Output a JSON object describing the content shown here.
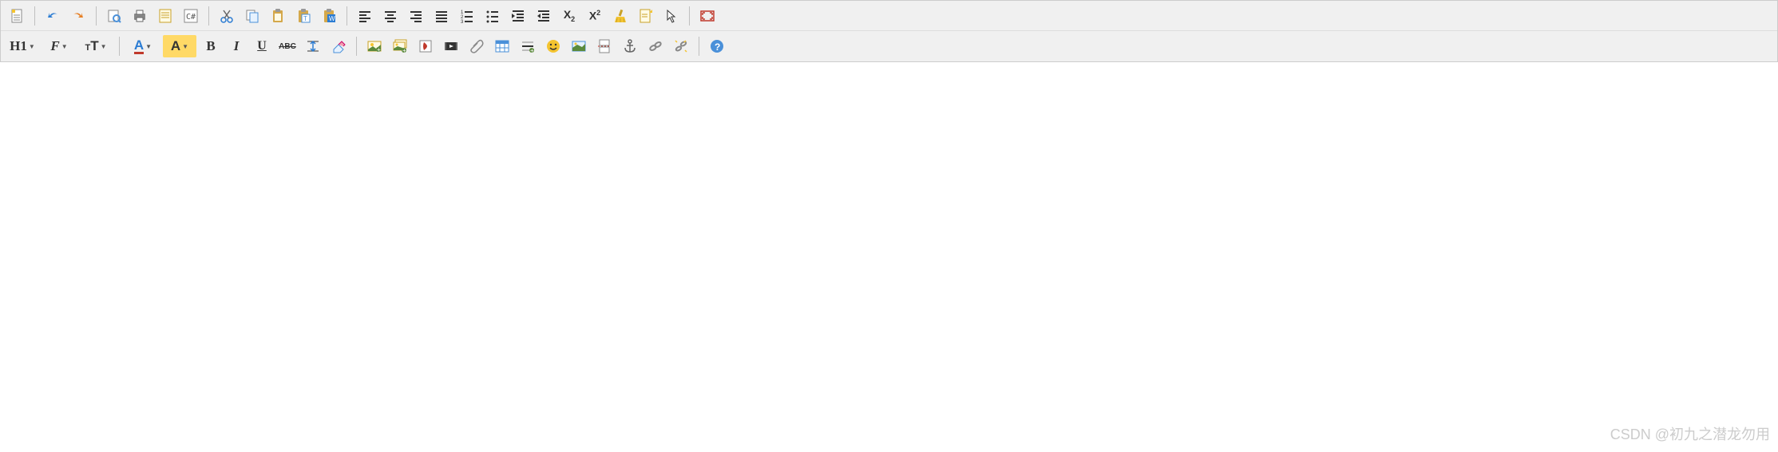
{
  "toolbar_row1": {
    "source": "Source",
    "undo": "Undo",
    "redo": "Redo",
    "preview": "Preview",
    "print": "Print",
    "template": "Template",
    "csharp": "C#",
    "cut": "Cut",
    "copy": "Copy",
    "paste": "Paste",
    "paste_text": "Paste as text",
    "paste_word": "Paste from Word",
    "align_left": "Align Left",
    "align_center": "Align Center",
    "align_right": "Align Right",
    "align_justify": "Justify",
    "ordered_list": "Ordered List",
    "unordered_list": "Unordered List",
    "indent": "Increase Indent",
    "outdent": "Decrease Indent",
    "subscript": "Subscript",
    "superscript": "Superscript",
    "clean": "Remove Format",
    "edit_source": "Edit Source",
    "select": "Select",
    "fullscreen": "Fullscreen"
  },
  "toolbar_row2": {
    "heading_label": "H1",
    "font_family": "F",
    "font_size": "T",
    "font_size_prefix": "T",
    "fore_color": "A",
    "back_color": "A",
    "bold": "B",
    "italic": "I",
    "underline": "U",
    "strike": "ABC",
    "baseline": "Baseline",
    "eraser": "Eraser",
    "image": "Image",
    "multiimage": "Multi Image",
    "flash": "Flash",
    "media": "Media",
    "attachment": "Attachment",
    "table": "Table",
    "hr": "HR",
    "emoji": "Emoji",
    "map": "Map",
    "code": "Code",
    "anchor": "Anchor",
    "link": "Link",
    "unlink": "Unlink",
    "about": "About"
  },
  "watermark": "CSDN @初九之潜龙勿用"
}
